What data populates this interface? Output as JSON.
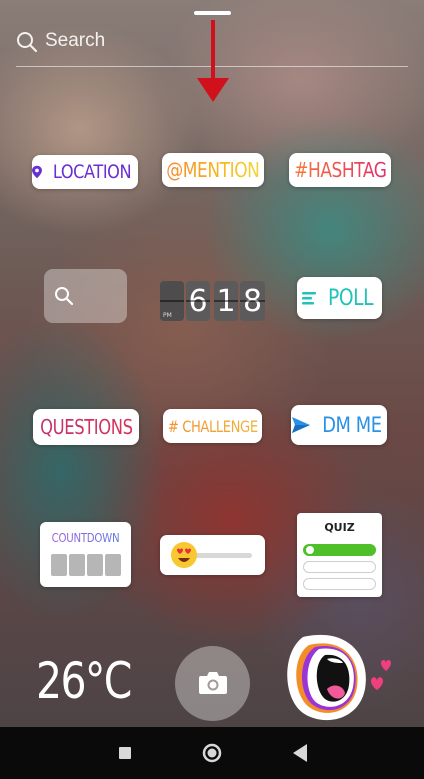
{
  "search": {
    "placeholder": "Search"
  },
  "stickers": {
    "location": "LOCATION",
    "mention": "@MENTION",
    "hashtag": "#HASHTAG",
    "clock": {
      "hour": "6",
      "minute_tens": "1",
      "minute_ones": "8",
      "meridiem": "PM"
    },
    "poll": "POLL",
    "questions": "QUESTIONS",
    "challenge": "# CHALLENGE",
    "dm": "DM ME",
    "countdown": "COUNTDOWN",
    "quiz": "QUIZ",
    "emoji_slider": {
      "emoji": "heart-eyes-emoji"
    }
  },
  "weather": {
    "temperature": "26°C"
  },
  "colors": {
    "location": "#6a2fd1",
    "poll": "#1fc3b8",
    "dm": "#2a92e6",
    "arrow": "#d0101a",
    "quiz_correct": "#4fbf2a"
  },
  "navbar": {
    "recents": "square-icon",
    "home": "circle-icon",
    "back": "triangle-back-icon"
  }
}
